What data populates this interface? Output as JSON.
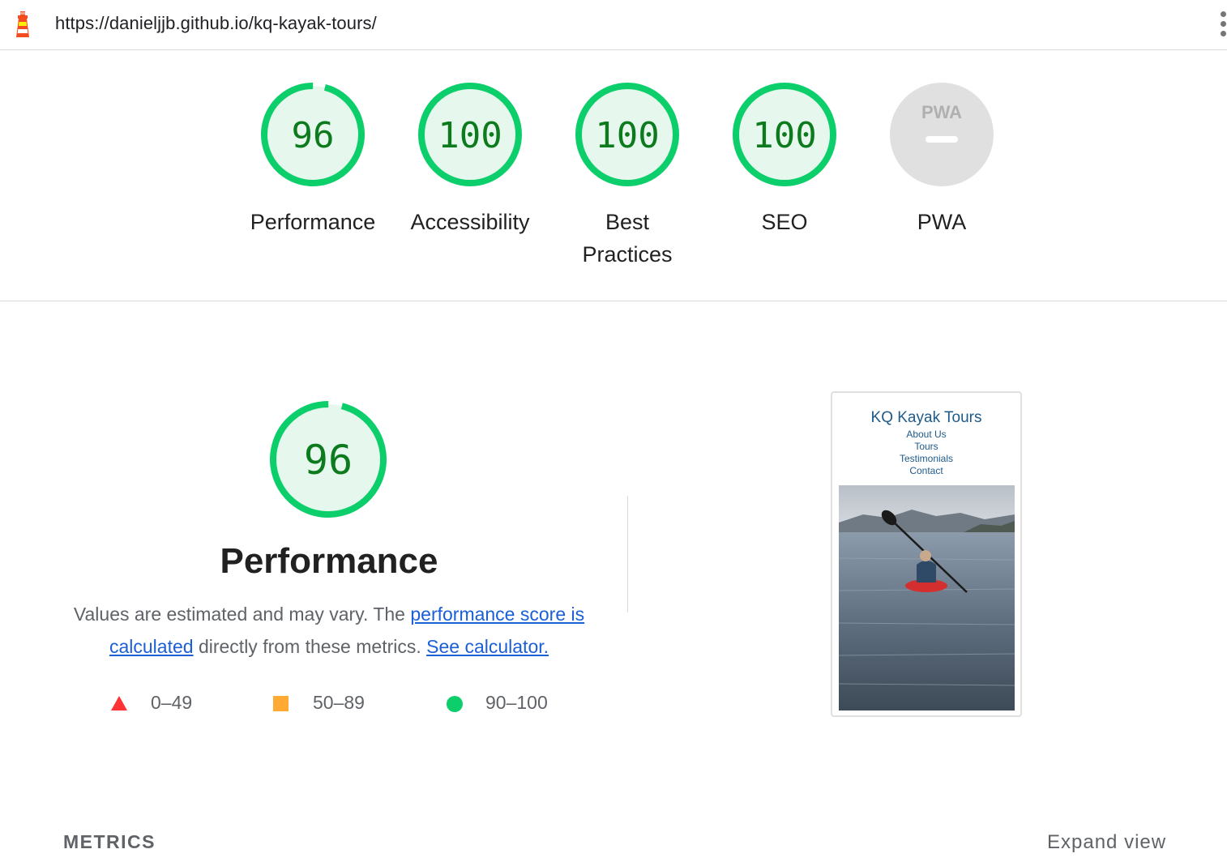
{
  "header": {
    "url": "https://danieljjb.github.io/kq-kayak-tours/",
    "logo_icon": "lighthouse-icon",
    "menu_icon": "more-vertical-icon"
  },
  "scores": [
    {
      "label": "Performance",
      "value": "96",
      "fraction": 0.96
    },
    {
      "label": "Accessibility",
      "value": "100",
      "fraction": 1.0
    },
    {
      "label": "Best Practices",
      "value": "100",
      "fraction": 1.0
    },
    {
      "label": "SEO",
      "value": "100",
      "fraction": 1.0
    },
    {
      "label": "PWA",
      "value": "",
      "badge": "PWA"
    }
  ],
  "performance": {
    "score": "96",
    "fraction": 0.96,
    "title": "Performance",
    "desc_1": "Values are estimated and may vary. The ",
    "link_1": "performance score is calculated",
    "desc_2": " directly from these metrics. ",
    "link_2": "See calculator.",
    "legend": [
      {
        "icon": "fail-triangle-icon",
        "range": "0–49",
        "color": "#ff3333"
      },
      {
        "icon": "average-square-icon",
        "range": "50–89",
        "color": "#ffaa33"
      },
      {
        "icon": "pass-circle-icon",
        "range": "90–100",
        "color": "#0cce6b"
      }
    ]
  },
  "screenshot": {
    "site_title": "KQ Kayak Tours",
    "nav": [
      "About Us",
      "Tours",
      "Testimonials",
      "Contact"
    ]
  },
  "metrics": {
    "heading": "METRICS",
    "expand_label": "Expand view"
  },
  "colors": {
    "pass": "#0cce6b",
    "pass_fill": "#e6f8ee",
    "pass_text": "#0c7a1d",
    "link": "#1a5fd6"
  }
}
